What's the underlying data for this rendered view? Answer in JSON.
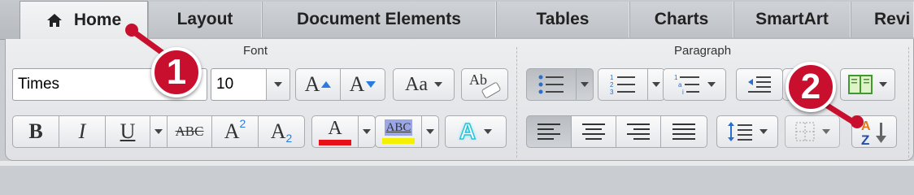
{
  "tabs": [
    {
      "label": "Home",
      "active": true
    },
    {
      "label": "Layout"
    },
    {
      "label": "Document Elements"
    },
    {
      "label": "Tables"
    },
    {
      "label": "Charts"
    },
    {
      "label": "SmartArt"
    },
    {
      "label": "Revi"
    }
  ],
  "font_group": {
    "label": "Font",
    "font_name": "Times",
    "font_size": "10",
    "grow_glyph": "A",
    "shrink_glyph": "A",
    "change_case_glyph": "Aa",
    "clear_format_glyph": "Ab",
    "bold_glyph": "B",
    "italic_glyph": "I",
    "underline_glyph": "U",
    "strike_glyph": "ABC",
    "superscript_glyph": "A",
    "superscript_mark": "2",
    "subscript_glyph": "A",
    "subscript_mark": "2",
    "font_color_glyph": "A",
    "highlight_glyph": "ABC",
    "text_effect_glyph": "A",
    "font_color": "#e8111a",
    "highlight_color": "#f3f000"
  },
  "paragraph_group": {
    "label": "Paragraph"
  },
  "callouts": [
    "1",
    "2"
  ],
  "accent_color": "#c8102e"
}
